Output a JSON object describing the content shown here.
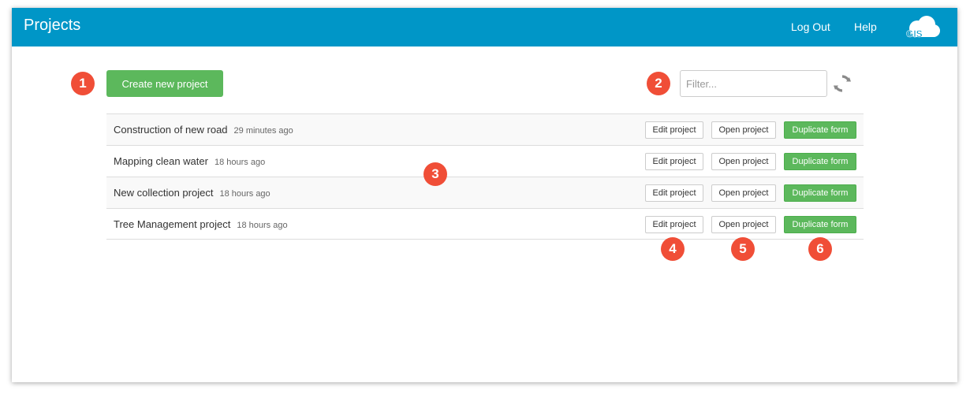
{
  "header": {
    "title": "Projects",
    "logout_label": "Log Out",
    "help_label": "Help",
    "logo_text": "GIS"
  },
  "toolbar": {
    "create_label": "Create new project",
    "filter_placeholder": "Filter...",
    "filter_value": ""
  },
  "projects": [
    {
      "name": "Construction of new road",
      "time": "29 minutes ago"
    },
    {
      "name": "Mapping clean water",
      "time": "18 hours ago"
    },
    {
      "name": "New collection project",
      "time": "18 hours ago"
    },
    {
      "name": "Tree Management project",
      "time": "18 hours ago"
    }
  ],
  "row_actions": {
    "edit_label": "Edit project",
    "open_label": "Open project",
    "duplicate_label": "Duplicate form"
  },
  "callouts": [
    "1",
    "2",
    "3",
    "4",
    "5",
    "6"
  ],
  "colors": {
    "header_bg": "#0096c7",
    "primary_green": "#5cb85c",
    "callout_red": "#f04e37"
  },
  "icons": {
    "refresh": "refresh-icon",
    "logo": "cloud-logo-icon"
  }
}
